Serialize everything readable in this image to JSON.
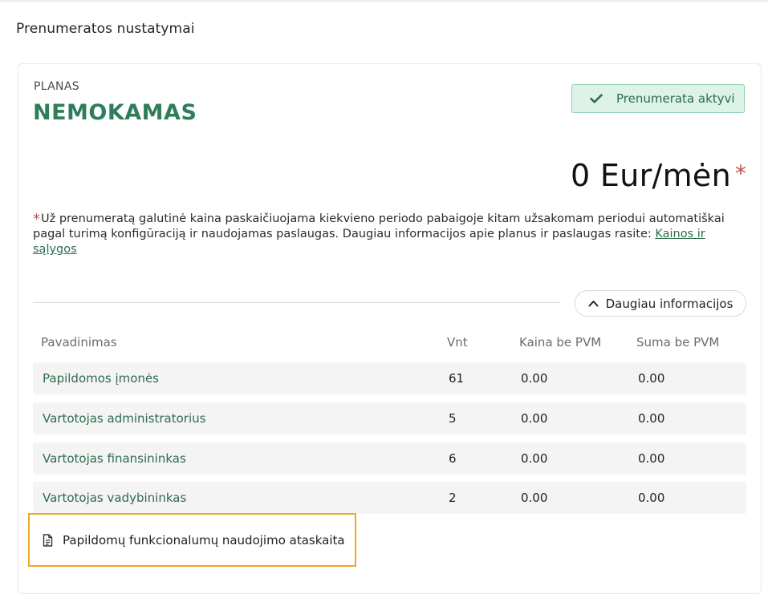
{
  "page": {
    "title": "Prenumeratos nustatymai"
  },
  "plan": {
    "label": "PLANAS",
    "name": "NEMOKAMAS",
    "status": "Prenumerata aktyvi",
    "price": "0 Eur/mėn",
    "price_marker": "*"
  },
  "note": {
    "marker": "*",
    "text": "Už prenumeratą galutinė kaina paskaičiuojama kiekvieno periodo pabaigoje kitam užsakomam periodui automatiškai pagal turimą konfigūraciją ir naudojamas paslaugas. Daugiau informacijos apie planus ir paslaugas rasite: ",
    "link_text": "Kainos ir sąlygos"
  },
  "more_button": {
    "label": "Daugiau informacijos"
  },
  "table": {
    "headers": [
      "Pavadinimas",
      "Vnt",
      "Kaina be PVM",
      "Suma be PVM"
    ],
    "rows": [
      {
        "name": "Papildomos įmonės",
        "qty": "61",
        "price": "0.00",
        "sum": "0.00"
      },
      {
        "name": "Vartotojas administratorius",
        "qty": "5",
        "price": "0.00",
        "sum": "0.00"
      },
      {
        "name": "Vartotojas finansininkas",
        "qty": "6",
        "price": "0.00",
        "sum": "0.00"
      },
      {
        "name": "Vartotojas vadybininkas",
        "qty": "2",
        "price": "0.00",
        "sum": "0.00"
      }
    ]
  },
  "report": {
    "label": "Papildomų funkcionalumų naudojimo ataskaita"
  },
  "icons": {
    "status": "check-icon",
    "more": "chevron-up-icon",
    "report": "document-icon"
  },
  "colors": {
    "accent": "#2e7d5b",
    "badge_bg": "#def3e8",
    "highlight": "#f0a81c",
    "required": "#c0504d"
  }
}
